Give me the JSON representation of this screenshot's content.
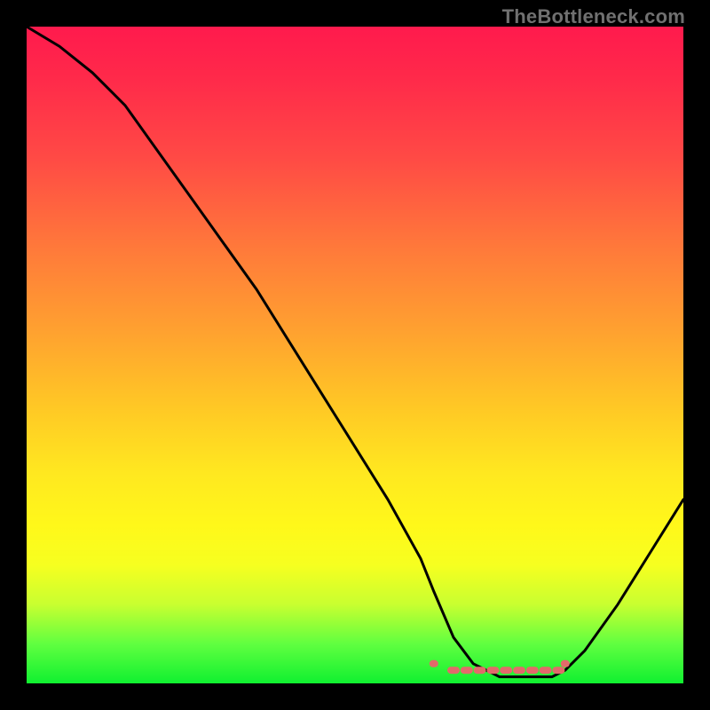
{
  "attribution": "TheBottleneck.com",
  "chart_data": {
    "type": "line",
    "title": "",
    "xlabel": "",
    "ylabel": "",
    "xlim": [
      0,
      100
    ],
    "ylim": [
      0,
      100
    ],
    "series": [
      {
        "name": "bottleneck-curve",
        "x": [
          0,
          5,
          10,
          15,
          20,
          25,
          30,
          35,
          40,
          45,
          50,
          55,
          60,
          62,
          65,
          68,
          72,
          76,
          80,
          82,
          85,
          90,
          95,
          100
        ],
        "values": [
          100,
          97,
          93,
          88,
          81,
          74,
          67,
          60,
          52,
          44,
          36,
          28,
          19,
          14,
          7,
          3,
          1,
          1,
          1,
          2,
          5,
          12,
          20,
          28
        ]
      },
      {
        "name": "highlight-dots",
        "x": [
          62,
          65,
          67,
          69,
          71,
          73,
          75,
          77,
          79,
          81,
          82
        ],
        "values": [
          3,
          2,
          2,
          2,
          2,
          2,
          2,
          2,
          2,
          2,
          3
        ]
      }
    ],
    "colors": {
      "curve": "#000000",
      "dots": "#e26a6a"
    }
  }
}
